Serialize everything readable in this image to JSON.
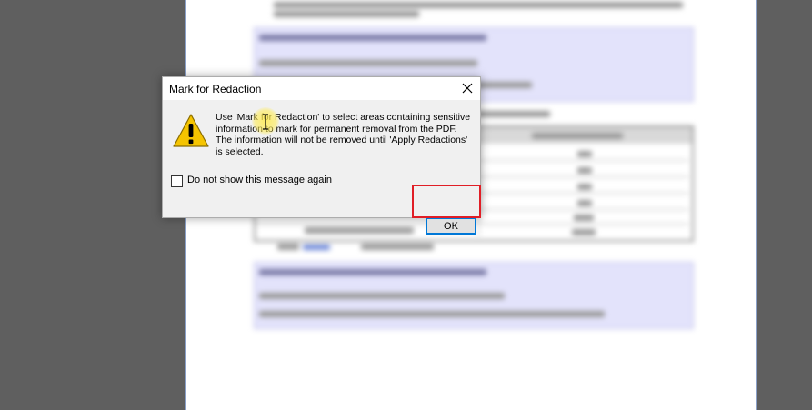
{
  "dialog": {
    "title": "Mark for Redaction",
    "message": "Use 'Mark for Redaction' to select areas containing sensitive information to mark for permanent removal from the PDF. The information will not be removed until 'Apply Redactions' is selected.",
    "checkbox_label": "Do not show this message again",
    "checkbox_checked": false,
    "ok_label": "OK"
  },
  "icons": {
    "close": "close-icon",
    "warning": "warning-icon",
    "cursor": "text-cursor-icon"
  },
  "colors": {
    "highlight_red": "#e01e26",
    "button_focus_blue": "#0078d7",
    "warning_yellow": "#f5c400",
    "cursor_yellow": "#ffeb50"
  }
}
